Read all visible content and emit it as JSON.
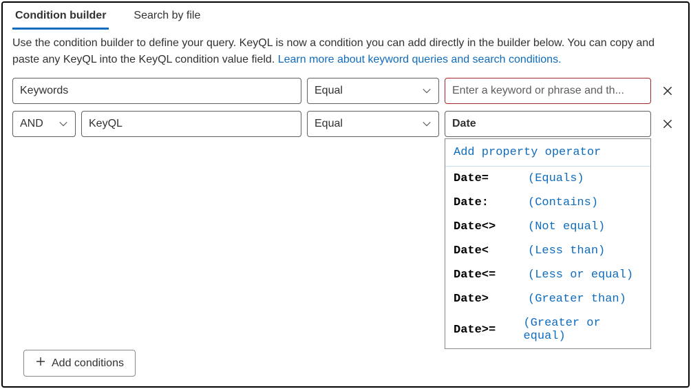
{
  "tabs": {
    "builder": "Condition builder",
    "byfile": "Search by file"
  },
  "description": {
    "text": "Use the condition builder to define your query. KeyQL is now a condition you can add directly in the builder below. You can copy and paste any KeyQL into the KeyQL condition value field. ",
    "link": "Learn more about keyword queries and search conditions."
  },
  "row1": {
    "property": "Keywords",
    "operator": "Equal",
    "value_placeholder": "Enter a keyword or phrase and th..."
  },
  "row2": {
    "logic": "AND",
    "property": "KeyQL",
    "operator": "Equal",
    "typed": "Date"
  },
  "add_btn": "Add conditions",
  "ac": {
    "header": "Add property operator",
    "items": [
      {
        "op": "Date=",
        "label": "(Equals)"
      },
      {
        "op": "Date:",
        "label": "(Contains)"
      },
      {
        "op": "Date<>",
        "label": "(Not equal)"
      },
      {
        "op": "Date<",
        "label": "(Less than)"
      },
      {
        "op": "Date<=",
        "label": "(Less or equal)"
      },
      {
        "op": "Date>",
        "label": "(Greater than)"
      },
      {
        "op": "Date>=",
        "label": "(Greater or equal)"
      }
    ]
  }
}
